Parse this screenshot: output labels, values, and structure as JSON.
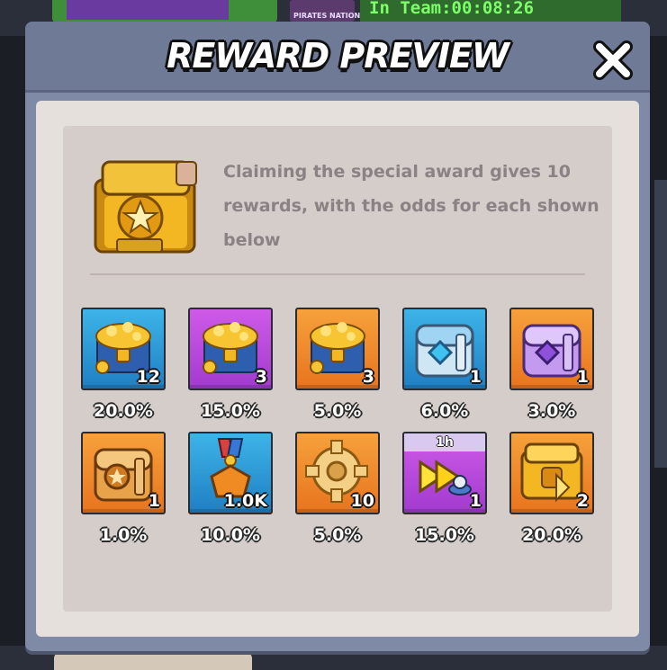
{
  "background": {
    "badge_text": "PIRATES NATION",
    "team_timer": "In Team:00:08:26"
  },
  "modal": {
    "title": "REWARD PREVIEW",
    "close_icon": "close-icon",
    "description": "Claiming the special award gives 10 rewards, with the odds for each shown below",
    "chest_icon": "golden-special-chest-icon"
  },
  "rewards": [
    {
      "icon": "gold-chest-icon",
      "bg": "blue",
      "count": "12",
      "odds": "20.0%"
    },
    {
      "icon": "gold-chest-icon",
      "bg": "purple",
      "count": "3",
      "odds": "15.0%"
    },
    {
      "icon": "gold-chest-icon",
      "bg": "orange",
      "count": "3",
      "odds": "5.0%"
    },
    {
      "icon": "silver-chest-icon",
      "bg": "blue",
      "count": "1",
      "odds": "6.0%"
    },
    {
      "icon": "purple-chest-icon",
      "bg": "orange",
      "count": "1",
      "odds": "3.0%"
    },
    {
      "icon": "bronze-star-chest-icon",
      "bg": "orange",
      "count": "1",
      "odds": "1.0%"
    },
    {
      "icon": "medal-icon",
      "bg": "blue",
      "count": "1.0K",
      "odds": "10.0%"
    },
    {
      "icon": "gear-icon",
      "bg": "orange",
      "count": "10",
      "odds": "5.0%"
    },
    {
      "icon": "speedup-icon",
      "bg": "purple",
      "count": "1",
      "odds": "15.0%",
      "timer": "1h"
    },
    {
      "icon": "golden-chest-icon",
      "bg": "orange",
      "count": "2",
      "odds": "20.0%"
    }
  ],
  "colors": {
    "tile_blue": "#1f7fc3",
    "tile_purple": "#a13bcf",
    "tile_orange": "#e8741f",
    "description_text": "#8a8284"
  }
}
